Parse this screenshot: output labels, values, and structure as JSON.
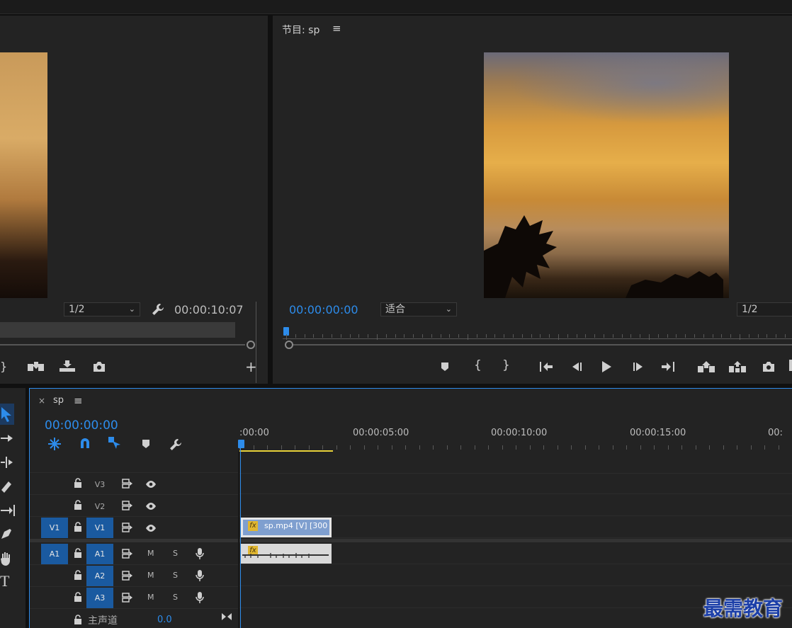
{
  "source_monitor": {
    "zoom_select": "1/2",
    "timecode": "00:00:10:07"
  },
  "program_monitor": {
    "title": "节目: sp",
    "timecode": "00:00:00:00",
    "fit_select": "适合",
    "zoom_select": "1/2"
  },
  "timeline": {
    "tab_name": "sp",
    "timecode": "00:00:00:00",
    "ruler_labels": [
      ":00:00",
      "00:00:05:00",
      "00:00:10:00",
      "00:00:15:00",
      "00:"
    ],
    "video_tracks": [
      {
        "name": "V3",
        "target": ""
      },
      {
        "name": "V2",
        "target": ""
      },
      {
        "name": "V1",
        "target": "V1"
      }
    ],
    "audio_tracks": [
      {
        "name": "A1",
        "target": "A1",
        "mute": "M",
        "solo": "S"
      },
      {
        "name": "A2",
        "target": "",
        "mute": "M",
        "solo": "S"
      },
      {
        "name": "A3",
        "target": "",
        "mute": "M",
        "solo": "S"
      }
    ],
    "master": {
      "label": "主声道",
      "value": "0.0"
    },
    "video_clip_label": "sp.mp4 [V] [300",
    "fx_badge": "fx"
  },
  "watermark": "最需教育",
  "colors": {
    "accent_blue": "#2d8ceb",
    "target_blue": "#1a5aa0",
    "clip_video": "#7f9fcf",
    "clip_audio": "#d9d9d9",
    "work_area": "#e8d23a"
  }
}
